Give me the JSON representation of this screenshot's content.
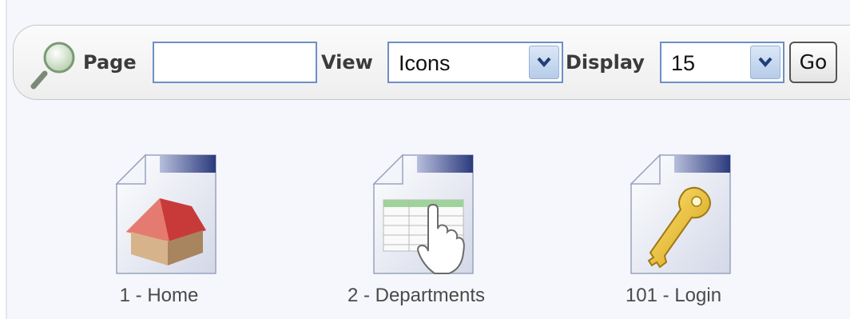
{
  "toolbar": {
    "page_label": "Page",
    "page_value": "",
    "view_label": "View",
    "view_selected": "Icons",
    "display_label": "Display",
    "display_selected": "15",
    "go_label": "Go"
  },
  "pages": [
    {
      "label": "1 - Home",
      "icon": "home-page-icon"
    },
    {
      "label": "2 - Departments",
      "icon": "form-page-icon"
    },
    {
      "label": "101 - Login",
      "icon": "login-page-icon"
    }
  ],
  "colors": {
    "select_border": "#6d8fc8",
    "select_button": "#b6cbe9",
    "page_header_bar": "#2b3a7d"
  }
}
